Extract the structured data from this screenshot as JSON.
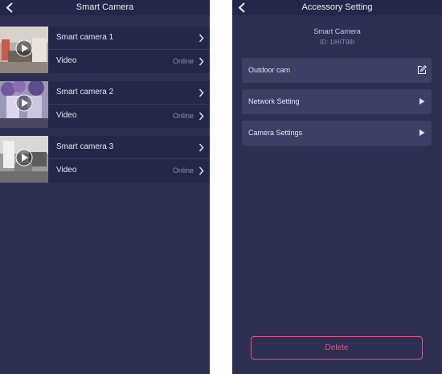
{
  "left_screen": {
    "title": "Smart Camera",
    "cameras": [
      {
        "name": "Smart camera 1",
        "sub_label": "Video",
        "status": "Online"
      },
      {
        "name": "Smart camera 2",
        "sub_label": "Video",
        "status": "Online"
      },
      {
        "name": "Smart camera 3",
        "sub_label": "Video",
        "status": "Online"
      }
    ]
  },
  "right_screen": {
    "title": "Accessory Setting",
    "device_name": "Smart Camera",
    "device_id": "ID: 1IHIT98I",
    "settings": [
      {
        "label": "Outdoor cam",
        "icon": "edit-icon"
      },
      {
        "label": "Network Setting",
        "icon": "play-arrow-icon"
      },
      {
        "label": "Camera Settings",
        "icon": "play-arrow-icon"
      }
    ],
    "delete_label": "Delete"
  },
  "colors": {
    "background": "#2d2f53",
    "navbar": "#25274a",
    "row": "#24264a",
    "setting_row": "#3d3f64",
    "delete_accent": "#e1567a"
  }
}
